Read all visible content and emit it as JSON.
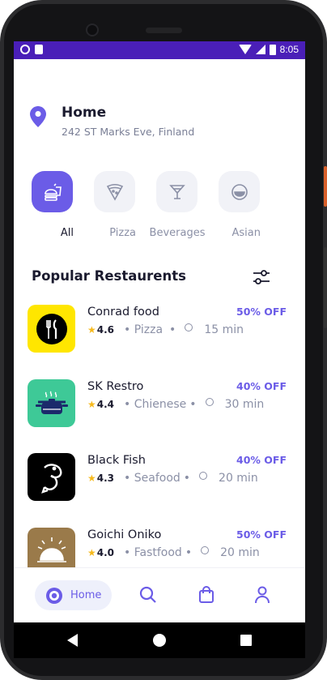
{
  "status_bar": {
    "time": "8:05"
  },
  "location": {
    "title": "Home",
    "address": "242 ST Marks Eve, Finland"
  },
  "categories": [
    {
      "label": "All",
      "icon": "fastfood-icon",
      "active": true
    },
    {
      "label": "Pizza",
      "icon": "pizza-icon",
      "active": false
    },
    {
      "label": "Beverages",
      "icon": "cocktail-icon",
      "active": false
    },
    {
      "label": "Asian",
      "icon": "rice-bowl-icon",
      "active": false
    }
  ],
  "section": {
    "title": "Popular Restaurents"
  },
  "restaurants": [
    {
      "name": "Conrad food",
      "discount": "50% OFF",
      "rating": "4.6",
      "category": "• Pizza",
      "sep": "•",
      "time": "15 min",
      "logo": "fork-knife-icon",
      "logo_bg": "#ffe600"
    },
    {
      "name": "SK Restro",
      "discount": "40% OFF",
      "rating": "4.4",
      "category": "• Chienese",
      "sep": "•",
      "time": "30 min",
      "logo": "cooking-pot-icon",
      "logo_bg": "#3ec997"
    },
    {
      "name": "Black Fish",
      "discount": "40% OFF",
      "rating": "4.3",
      "category": "• Seafood",
      "sep": "•",
      "time": "20 min",
      "logo": "fish-icon",
      "logo_bg": "#000000"
    },
    {
      "name": "Goichi Oniko",
      "discount": "50% OFF",
      "rating": "4.0",
      "category": "• Fastfood",
      "sep": "•",
      "time": "20 min",
      "logo": "cloche-icon",
      "logo_bg": "#9a7a4a"
    }
  ],
  "bottom_nav": {
    "home_label": "Home"
  },
  "colors": {
    "accent": "#6b5ce7",
    "status_bar": "#4a1fb8",
    "text_dark": "#1a1a2e",
    "text_muted": "#8b90a6"
  }
}
